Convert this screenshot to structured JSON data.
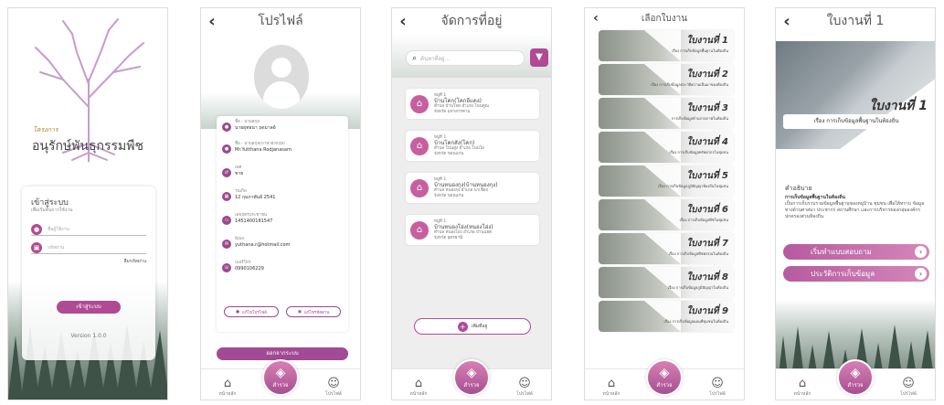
{
  "screen1": {
    "tagline_small": "โครงการ",
    "title": "อนุรักษ์พันธุกรรมพืช",
    "card_title": "เข้าสู่ระบบ",
    "card_subtitle": "เพื่อเริ่มต้นการใช้งาน",
    "username_placeholder": "ชื่อผู้ใช้งาน",
    "password_placeholder": "รหัสผ่าน",
    "forgot": "ลืมรหัสผ่าน",
    "login_button": "เข้าสู่ระบบ",
    "version": "Version 1.0.0"
  },
  "screen2": {
    "title": "โปรไฟล์",
    "fields": [
      {
        "label": "ชื่อ - นามสกุล",
        "value": "นายยุทธนา ฤดมาลย์"
      },
      {
        "label": "ชื่อ - นามสกุล(ภาษาอังกฤษ)",
        "value": "Mr.Yutthana Rodjanasam"
      },
      {
        "label": "เพศ",
        "value": "ชาย"
      },
      {
        "label": "วันเกิด",
        "value": "12 กุมภาพันธ์ 2541"
      },
      {
        "label": "เลขบัตรประชาชน",
        "value": "1451400181547"
      },
      {
        "label": "อีเมล",
        "value": "yuthana.r@hotmail.com"
      },
      {
        "label": "เบอร์โทร",
        "value": "0990106229"
      }
    ],
    "edit_profile": "แก้ไขโปรไฟล์",
    "change_password": "แก้ไขรหัสผ่าน",
    "logout": "ออกจากระบบ"
  },
  "screen3": {
    "title": "จัดการที่อยู่",
    "search_placeholder": "ค้นหาที่อยู่...",
    "addresses": [
      {
        "moo": "หมู่ที่ 1",
        "name": "บ้านโคก(โคกอีแดง)",
        "line1": "ตำบล บ้านโจด   อำเภอ โนนคูณ",
        "line2": "จังหวัด มหาสารคาม"
      },
      {
        "moo": "หมู่ที่ 1",
        "name": "บ้านโคกสัง(โคก)",
        "line1": "ตำบล โนนสูง   อำเภอ โนนไผ่",
        "line2": "จังหวัด ขอนแก่น"
      },
      {
        "moo": "หมู่ที่ 1",
        "name": "บ้านหนองกุง(บ้านหนองกุง)",
        "line1": "ตำบล หนองกุง   อำเภอ นาเชือก",
        "line2": "จังหวัด ขอนแก่น"
      },
      {
        "moo": "หมู่ที่ 1",
        "name": "บ้านหนองโอ่ง(หนองโอ่ง)",
        "line1": "ตำบล หนองโอ่ง   อำเภอ บ้านแฮด",
        "line2": "จังหวัด อุดรธานี"
      }
    ],
    "add_button": "เพิ่มที่อยู่"
  },
  "screen4": {
    "title": "เลือกใบงาน",
    "worksheets": [
      {
        "title": "ใบงานที่ 1",
        "sub": "เรื่อง การเก็บข้อมูลพื้นฐานในท้องถิ่น"
      },
      {
        "title": "ใบงานที่ 2",
        "sub": "เรื่อง การเก็บข้อมูลประวัติความเป็นมาของท้องถิ่น"
      },
      {
        "title": "ใบงานที่ 3",
        "sub": "การเก็บข้อมูลด้านกายภาพในท้องถิ่น"
      },
      {
        "title": "ใบงานที่ 4",
        "sub": "เรื่อง การเก็บข้อมูลทรัพยากรในชุมชน"
      },
      {
        "title": "ใบงานที่ 5",
        "sub": "เรื่อง การเก็บข้อมูลภูมิปัญญาท้องถิ่นในชุมชน"
      },
      {
        "title": "ใบงานที่ 6",
        "sub": "เรื่อง การเก็บข้อมูลพืชในชุมชน"
      },
      {
        "title": "ใบงานที่ 7",
        "sub": "เรื่อง การเก็บข้อมูลพืชพรรณในท้องถิ่น"
      },
      {
        "title": "ใบงานที่ 8",
        "sub": "เรื่อง การเก็บข้อมูลภูมิปัญญาในท้องถิ่น"
      },
      {
        "title": "ใบงานที่ 9",
        "sub": "เรื่อง การเก็บข้อมูลแผนที่ชุมชนในท้องถิ่น"
      }
    ]
  },
  "screen5": {
    "title": "ใบงานที่ 1",
    "banner_title": "ใบงานที่ 1",
    "banner_sub": "เรื่อง การเก็บข้อมูลพื้นฐานในท้องถิ่น",
    "desc_heading": "คำอธิบาย",
    "desc_bold": "การเก็บข้อมูลพื้นฐานในท้องถิ่น",
    "desc_text": "เป็นการเก็บรวบรวมข้อมูลพื้นฐานของหมู่บ้าน ชุมชน เพื่อให้ทราบ ข้อมูลทางด้านศาสนา ประชากร สถานศึกษา และการบริหารของกลุ่มองค์กรปกครองส่วนท้องถิ่น",
    "start_button": "เริ่มทำแบบสอบถาม",
    "history_button": "ประวัติการเก็บข้อมูล"
  },
  "nav": {
    "home": "หน้าหลัก",
    "survey": "สำรวจ",
    "profile": "โปรไฟล์"
  },
  "colors": {
    "accent": "#b14a94",
    "forest": "#53685e"
  }
}
